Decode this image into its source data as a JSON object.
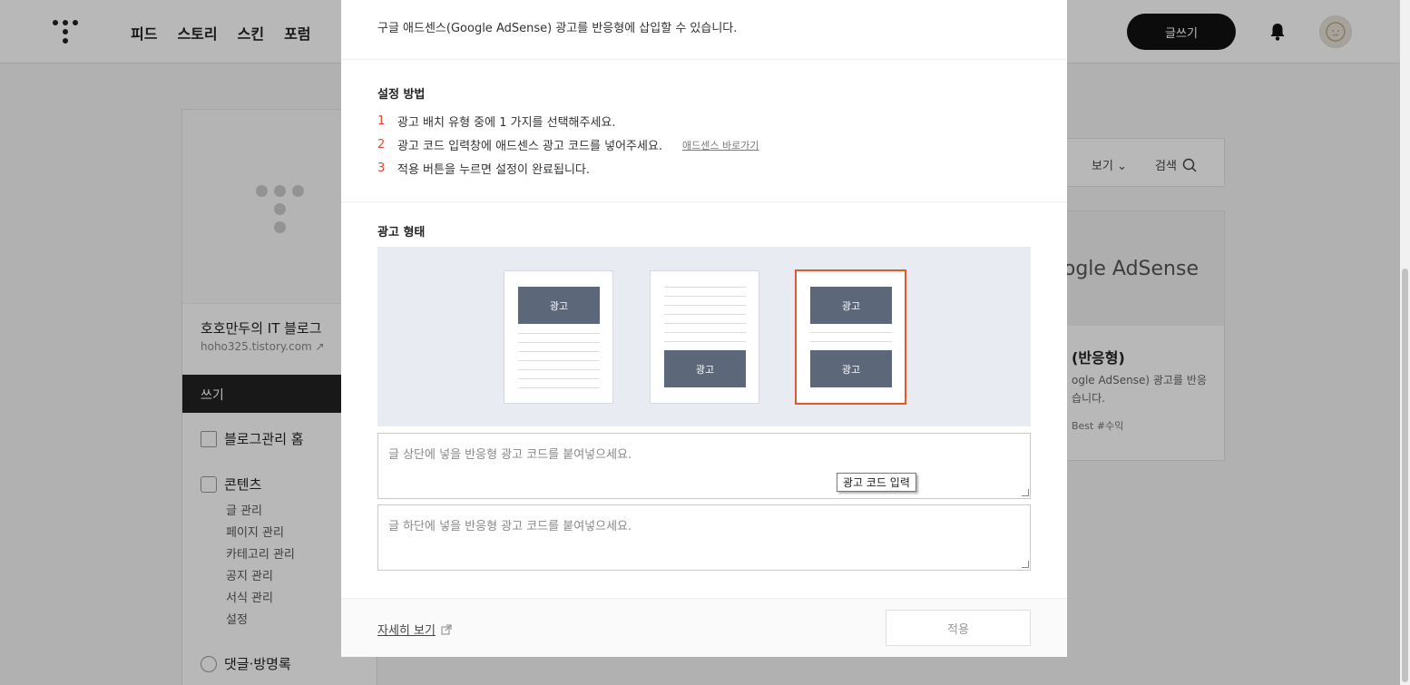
{
  "header": {
    "nav": [
      "피드",
      "스토리",
      "스킨",
      "포럼"
    ],
    "write_button": "글쓰기"
  },
  "sidebar": {
    "blog_title": "호호만두의 IT 블로그",
    "blog_url": "hoho325.tistory.com",
    "write_label": "쓰기",
    "menu_home": "블로그관리 홈",
    "menu_contents": "콘텐츠",
    "contents_sub": [
      "글 관리",
      "페이지 관리",
      "카테고리 관리",
      "공지 관리",
      "서식 관리",
      "설정"
    ],
    "menu_comments": "댓글·방명록"
  },
  "right_panel": {
    "view_label": "보기",
    "search_label": "검색",
    "card_logo": "ogle AdSense",
    "card_title": "(반응형)",
    "card_desc_1": "ogle AdSense) 광고를 반응",
    "card_desc_2": "습니다.",
    "card_tags": "Best   #수익"
  },
  "modal": {
    "intro": "구글 애드센스(Google AdSense) 광고를 반응형에 삽입할 수 있습니다.",
    "setup_heading": "설정 방법",
    "steps": [
      {
        "num": "1",
        "text": "광고 배치 유형 중에 1 가지를 선택해주세요."
      },
      {
        "num": "2",
        "text": "광고 코드 입력창에 애드센스 광고 코드를 넣어주세요.",
        "link": "애드센스 바로가기"
      },
      {
        "num": "3",
        "text": "적용 버튼을 누르면 설정이 완료됩니다."
      }
    ],
    "ad_type_heading": "광고 형태",
    "ad_label": "광고",
    "selected_option": 3,
    "top_code_placeholder": "글 상단에 넣을 반응형 광고 코드를 붙여넣으세요.",
    "bottom_code_placeholder": "글 하단에 넣을 반응형 광고 코드를 붙여넣으세요.",
    "tooltip": "광고 코드 입력",
    "more_link": "자세히 보기",
    "apply_button": "적용"
  },
  "colors": {
    "accent": "#e5453a",
    "selected_border": "#e05a2b",
    "ad_block": "#5c6779",
    "ad_area_bg": "#e8ebf1"
  }
}
